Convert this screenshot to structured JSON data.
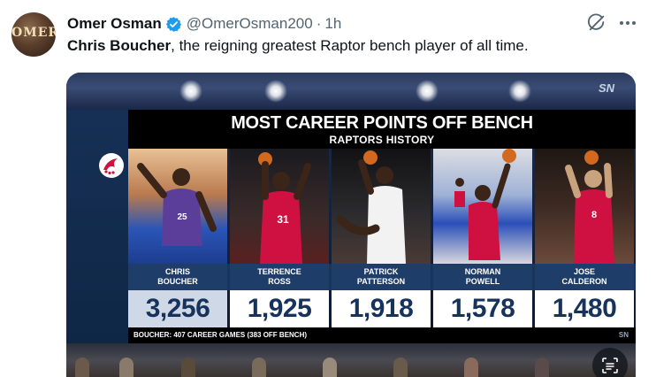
{
  "tweet": {
    "display_name": "Omer Osman",
    "handle": "@OmerOsman200",
    "separator": "·",
    "timestamp": "1h",
    "text_bold": "Chris Boucher",
    "text_rest": ", the reigning greatest Raptor bench player of all time.",
    "avatar_text": "OMER",
    "verified_color": "#1d9bf0"
  },
  "graphic": {
    "title": "MOST CAREER POINTS OFF BENCH",
    "subtitle": "RAPTORS HISTORY",
    "network_logo": "SN",
    "footnote": "BOUCHER: 407 CAREER GAMES (383 OFF BENCH)",
    "footer_tag": "SN",
    "players": [
      {
        "first": "CHRIS",
        "last": "BOUCHER",
        "points": "3,256",
        "jersey": "25"
      },
      {
        "first": "TERRENCE",
        "last": "ROSS",
        "points": "1,925",
        "jersey": "31"
      },
      {
        "first": "PATRICK",
        "last": "PATTERSON",
        "points": "1,918",
        "jersey": ""
      },
      {
        "first": "NORMAN",
        "last": "POWELL",
        "points": "1,578",
        "jersey": ""
      },
      {
        "first": "JOSE",
        "last": "CALDERON",
        "points": "1,480",
        "jersey": "8"
      }
    ],
    "colors": {
      "navy": "#17335c",
      "raptors_red": "#ce1141",
      "highlight": "#cfd8e6"
    }
  },
  "icons": {
    "verified": "verified-badge-icon",
    "grok": "grok-icon",
    "more": "more-icon",
    "scan": "text-recognition-icon"
  }
}
